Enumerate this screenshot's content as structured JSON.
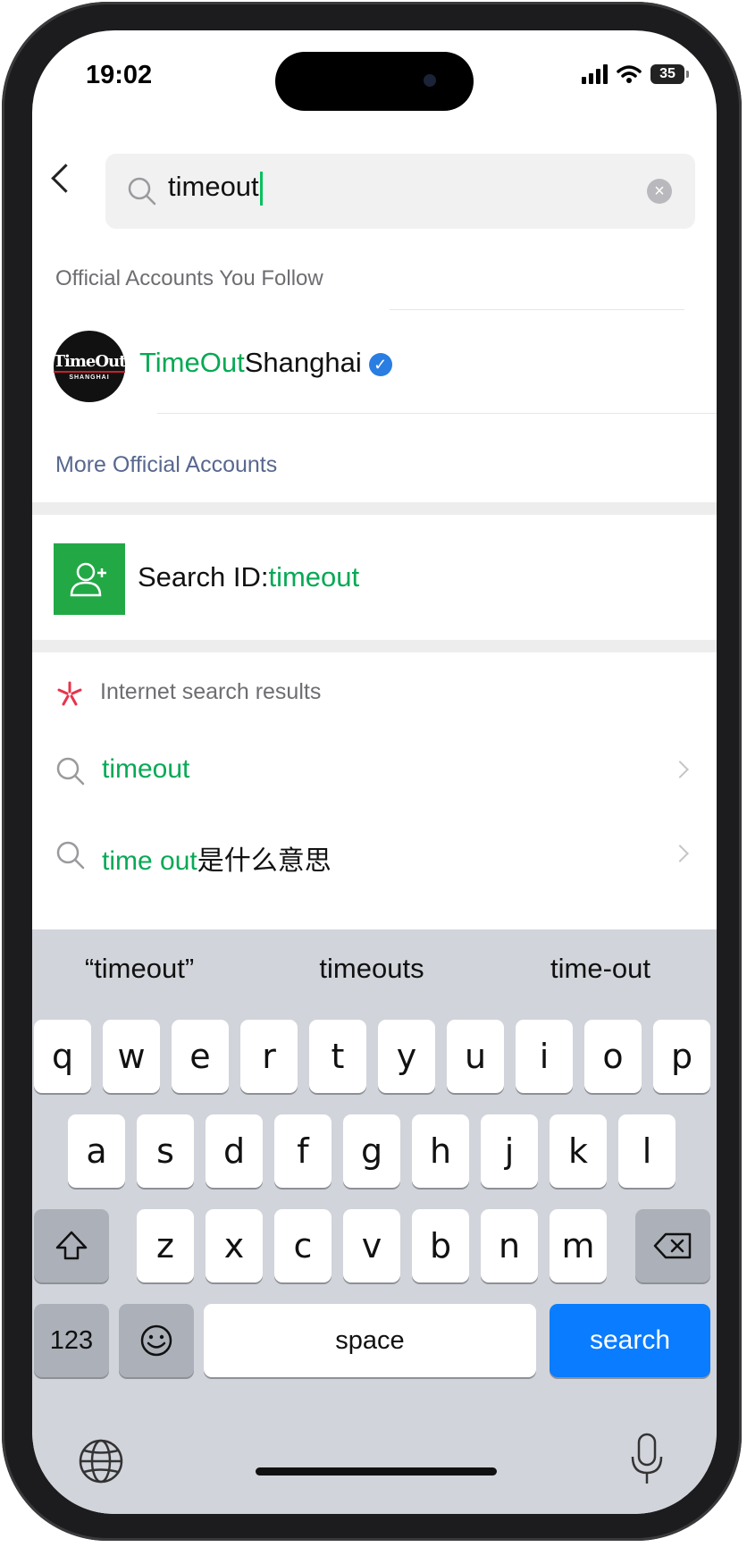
{
  "status_bar": {
    "time": "19:02",
    "battery": "35"
  },
  "search": {
    "query": "timeout"
  },
  "official_accounts": {
    "section_title": "Official Accounts You Follow",
    "account": {
      "name_match": "TimeOut",
      "name_rest": "Shanghai",
      "avatar_text_1": "TimeOut",
      "avatar_text_2": "SHANGHAI",
      "verified": true
    },
    "more_link": "More Official Accounts"
  },
  "search_id": {
    "prefix": "Search ID:",
    "value": "timeout"
  },
  "internet_results": {
    "title": "Internet search results",
    "items": [
      {
        "match": "timeout",
        "rest": ""
      },
      {
        "match": "time out",
        "rest": "是什么意思"
      }
    ]
  },
  "keyboard": {
    "predictions": [
      "“timeout”",
      "timeouts",
      "time-out"
    ],
    "row1": [
      "q",
      "w",
      "e",
      "r",
      "t",
      "y",
      "u",
      "i",
      "o",
      "p"
    ],
    "row2": [
      "a",
      "s",
      "d",
      "f",
      "g",
      "h",
      "j",
      "k",
      "l"
    ],
    "row3": [
      "z",
      "x",
      "c",
      "v",
      "b",
      "n",
      "m"
    ],
    "numbers_key": "123",
    "space_key": "space",
    "search_key": "search"
  },
  "colors": {
    "accent_green": "#07a955",
    "keyboard_blue": "#0a7cff",
    "verified_blue": "#2a7de1"
  }
}
